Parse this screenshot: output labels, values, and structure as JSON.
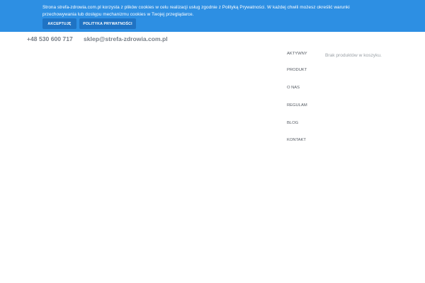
{
  "cookie_notice": {
    "text": "Strona strefa-zdrowia.com.pl korzysta z plików cookies w celu realizacji usług zgodnie z Polityką Prywatności. W każdej chwili możesz określić warunki przechowywania lub dostępu mechanizmu cookies w Twojej przeglądarce.",
    "accept_label": "AKCEPTUJĘ",
    "privacy_label": "POLITYKA PRYWATNOŚCI",
    "colors": {
      "bar": "#2d8fe3",
      "button": "#1f73c4"
    }
  },
  "contact": {
    "phone": "+48 530 600 717",
    "email": "sklep@strefa-zdrowia.com.pl"
  },
  "nav": {
    "items": [
      {
        "label": "AKTYWNY"
      },
      {
        "label": "PRODUKT"
      },
      {
        "label": "O NAS"
      },
      {
        "label": "REGULAM"
      },
      {
        "label": "BLOG"
      },
      {
        "label": "KONTAKT"
      }
    ]
  },
  "cart": {
    "empty_text": "Brak produktów w koszyku."
  }
}
